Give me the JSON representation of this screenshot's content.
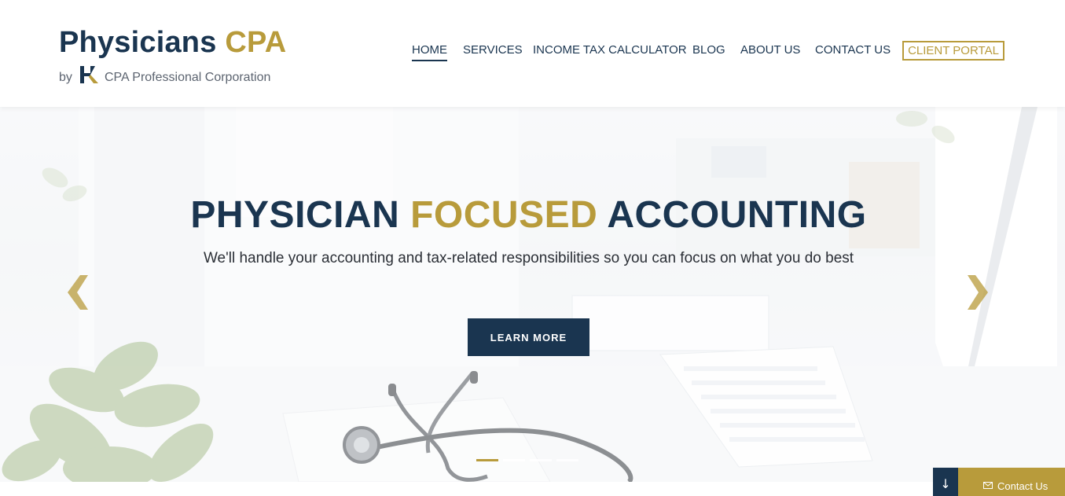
{
  "brand": {
    "title_main": "Physicians",
    "title_accent": "CPA",
    "by": "by",
    "corporation": "CPA Professional Corporation",
    "logo_icon": "hk-logo-icon"
  },
  "nav": {
    "items": [
      {
        "label": "HOME",
        "active": true
      },
      {
        "label": "SERVICES"
      },
      {
        "label": "INCOME TAX CALCULATOR"
      },
      {
        "label": "BLOG"
      },
      {
        "label": "ABOUT US"
      },
      {
        "label": "CONTACT US"
      }
    ],
    "portal_label": "CLIENT PORTAL"
  },
  "hero": {
    "title_part1": "PHYSICIAN",
    "title_accent": "FOCUSED",
    "title_part2": "ACCOUNTING",
    "subtitle": "We'll handle your accounting and tax-related responsibilities so you can focus on what you do best",
    "button_label": "LEARN MORE",
    "prev_icon": "chevron-left-icon",
    "next_icon": "chevron-right-icon",
    "slides_count": 4,
    "active_slide": 1
  },
  "footer_bar": {
    "scroll_icon": "arrow-down-icon",
    "scroll_glyph": "↓",
    "contact_label": "Contact Us",
    "contact_icon": "envelope-icon"
  },
  "colors": {
    "navy": "#1a3550",
    "gold": "#b89b3b"
  }
}
